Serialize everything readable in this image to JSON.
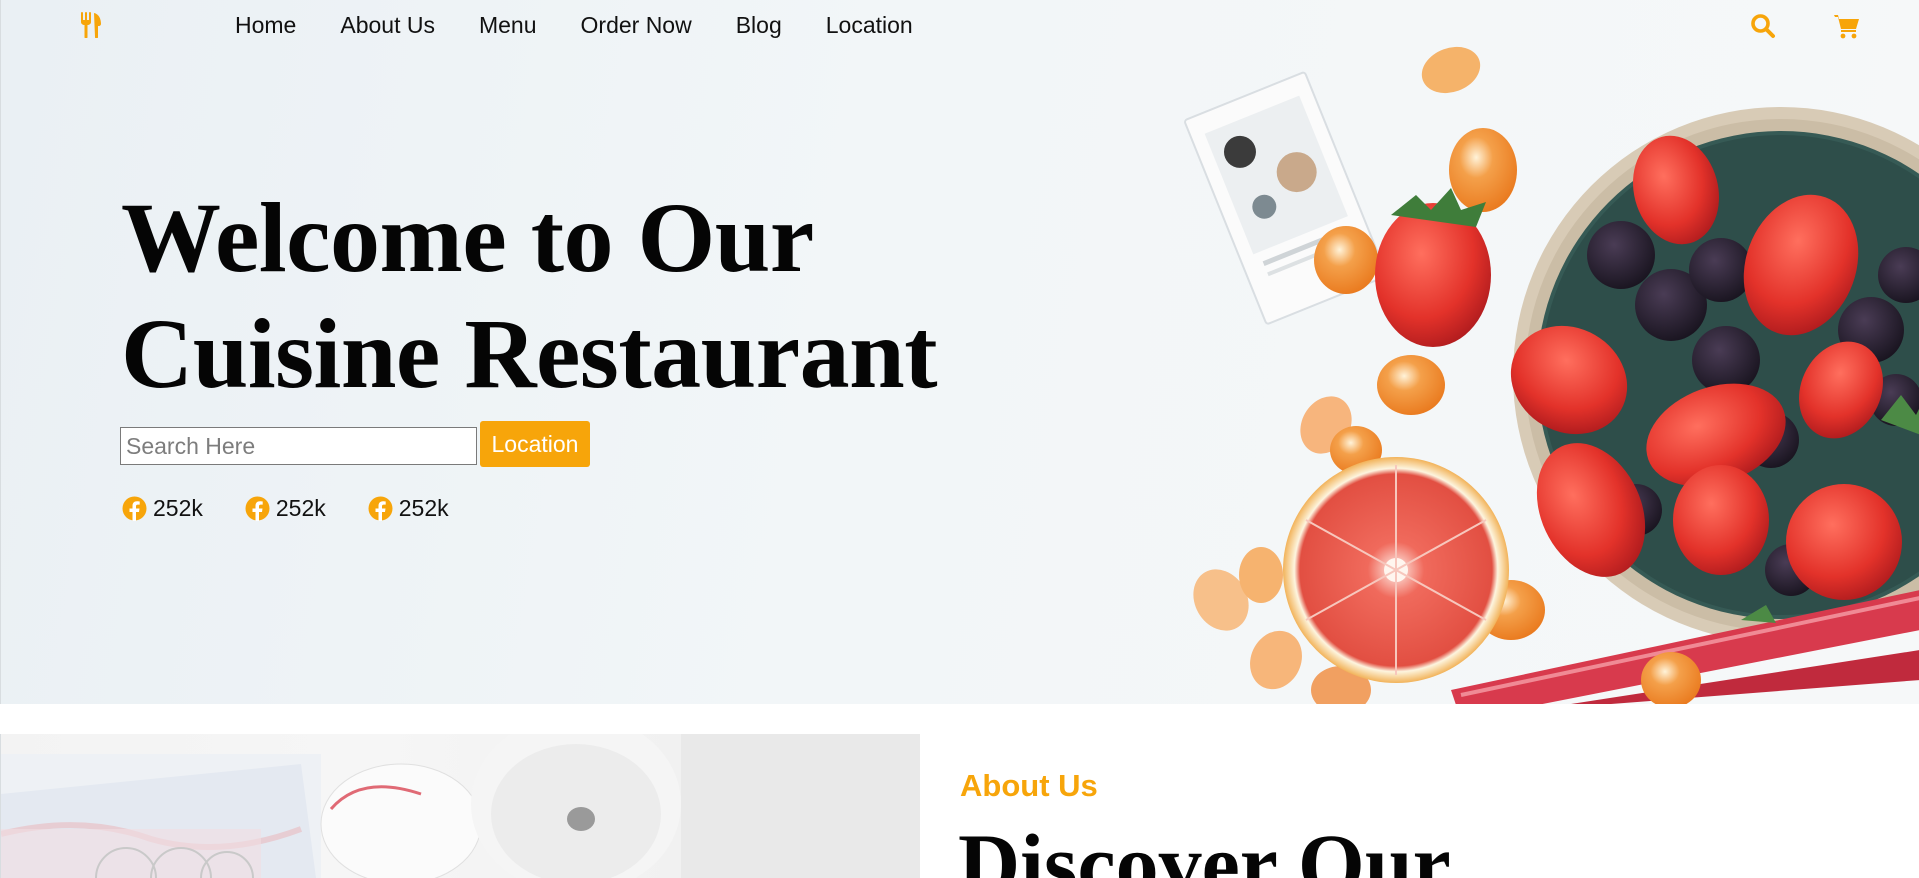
{
  "nav": {
    "logo_icon": "utensils-icon",
    "links": [
      "Home",
      "About Us",
      "Menu",
      "Order Now",
      "Blog",
      "Location"
    ],
    "search_icon": "search-icon",
    "cart_icon": "shopping-cart-icon"
  },
  "hero": {
    "headline_line1": "Welcome to Our",
    "headline_line2": "Cuisine Restaurant",
    "search": {
      "placeholder": "Search Here",
      "value": ""
    },
    "location_button": "Location",
    "social": [
      {
        "icon": "facebook-icon",
        "count": "252k"
      },
      {
        "icon": "facebook-icon",
        "count": "252k"
      },
      {
        "icon": "facebook-icon",
        "count": "252k"
      }
    ]
  },
  "about": {
    "eyebrow": "About Us",
    "title": "Discover Our"
  },
  "colors": {
    "accent": "#f7a50a",
    "text": "#111111",
    "hero_bg": "#eef3f6"
  }
}
